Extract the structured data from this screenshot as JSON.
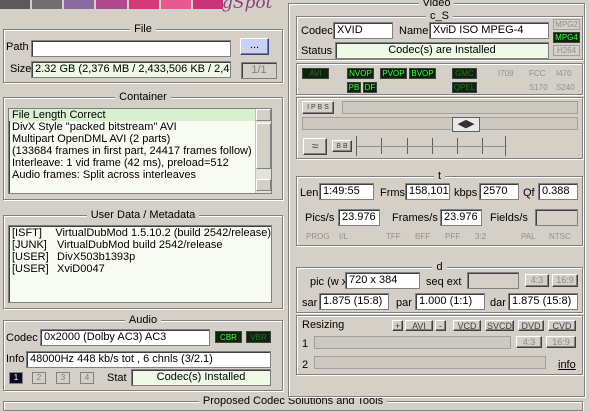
{
  "logo": {
    "text": "gSpot",
    "colors": [
      "#5a5a5a",
      "#707070",
      "#8a6aa0",
      "#b04a90",
      "#d23a7a",
      "#e45a90",
      "#c83278"
    ]
  },
  "file": {
    "title": "File",
    "path_label": "Path",
    "path_value": "",
    "browse_label": "...",
    "size_label": "Size",
    "size_value": "2.32 GB (2,376 MB / 2,433,506 KB / 2,4",
    "page": "1/1"
  },
  "container": {
    "title": "Container",
    "items": [
      "File Length Correct",
      "DivX Style \"packed bitstream\" AVI",
      "Multipart OpenDML AVI (2 parts)",
      "(133684 frames in first part, 24417 frames follow)",
      "Interleave: 1 vid frame (42 ms), preload=512",
      "Audio frames: Split across interleaves"
    ]
  },
  "metadata": {
    "title": "User Data / Metadata",
    "rows": [
      {
        "k": "[ISFT]",
        "v": "VirtualDubMod 1.5.10.2 (build 2542/release)"
      },
      {
        "k": "[JUNK]",
        "v": "VirtualDubMod build 2542/release"
      },
      {
        "k": "[USER]",
        "v": "DivX503b1393p"
      },
      {
        "k": "[USER]",
        "v": "XviD0047"
      }
    ]
  },
  "audio": {
    "title": "Audio",
    "codec_label": "Codec",
    "codec_value": "0x2000 (Dolby AC3) AC3",
    "cbr": "CBR",
    "vbr": "VBR",
    "info_label": "Info",
    "info_value": "48000Hz  448 kb/s tot , 6 chnls (3/2.1)",
    "tabs": [
      "1",
      "2",
      "3",
      "4"
    ],
    "stat_label": "Stat",
    "stat_value": "Codec(s) Installed"
  },
  "bottom": {
    "title": "Proposed Codec Solutions and Tools"
  },
  "video": {
    "title": "Video",
    "cs": {
      "title": "c_S",
      "codec_label": "Codec",
      "codec_value": "XVID",
      "name_label": "Name",
      "name_value": "XviD ISO MPEG-4",
      "status_label": "Status",
      "status_value": "Codec(s) are Installed",
      "mpg2": "MPG2",
      "mpg4": "MPG4",
      "h264": "H264"
    },
    "flags": {
      "avi": "AVI",
      "nvop": "NVOP",
      "pvop": "PVOP",
      "bvop": "BVOP",
      "gmc": "GMC",
      "qpel": "QPEL",
      "pb": "PB",
      "df": "DF",
      "i709": "I709",
      "fcc": "FCC",
      "i470": "I470",
      "s170": "S170",
      "s240": "S240"
    },
    "seq": {
      "ipbs": "I P B S",
      "bb": "B B"
    },
    "t": {
      "title": "t",
      "len_label": "Len",
      "len_value": "1:49:55",
      "frms_label": "Frms",
      "frms_value": "158,101",
      "kbps_label": "kbps",
      "kbps_value": "2570",
      "qf_label": "Qf",
      "qf_value": "0.388",
      "pics_label": "Pics/s",
      "pics_value": "23.976",
      "frames_label": "Frames/s",
      "frames_value": "23.976",
      "fields_label": "Fields/s",
      "fields_value": "",
      "prog": "PROG",
      "il": "I/L",
      "tff": "TFF",
      "bff": "BFF",
      "pff": "PFF",
      "b32": "3:2",
      "pal": "PAL",
      "ntsc": "NTSC"
    },
    "d": {
      "title": "d",
      "pic_label": "pic (w x",
      "pic_value": "720 x 384",
      "seqext_label": "seq ext",
      "seqext_value": "",
      "r43": "4:3",
      "r169": "16:9",
      "sar_label": "sar",
      "sar_value": "1.875 (15:8)",
      "par_label": "par",
      "par_value": "1.000 (1:1)",
      "dar_label": "dar",
      "dar_value": "1.875 (15:8)"
    },
    "resizing": {
      "label": "Resizing",
      "row1": "1",
      "row2": "2",
      "info": "info",
      "avi": "AVI",
      "vcd": "VCD",
      "svcd": "SVCD",
      "dvd": "DVD",
      "cvd": "CVD",
      "r43": "4:3",
      "r169": "16:9"
    }
  }
}
